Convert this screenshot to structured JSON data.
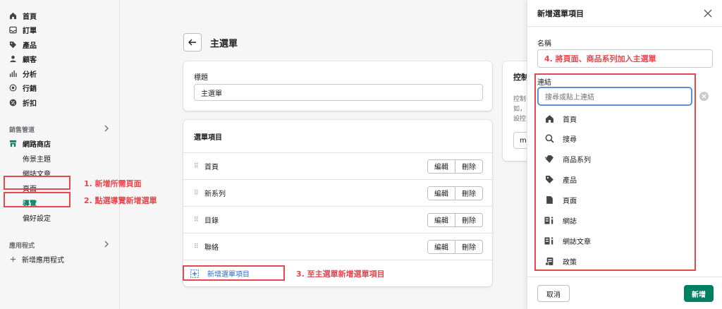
{
  "sidebar": {
    "items": [
      {
        "label": "首頁",
        "icon": "home-icon"
      },
      {
        "label": "訂單",
        "icon": "orders-icon"
      },
      {
        "label": "產品",
        "icon": "tag-icon"
      },
      {
        "label": "顧客",
        "icon": "person-icon"
      },
      {
        "label": "分析",
        "icon": "bar-chart-icon"
      },
      {
        "label": "行銷",
        "icon": "target-icon"
      },
      {
        "label": "折扣",
        "icon": "discount-icon"
      }
    ],
    "sales_channels_label": "銷售管道",
    "online_store_label": "網路商店",
    "store_sub": [
      "佈景主題",
      "網誌文章",
      "頁面",
      "導覽",
      "偏好設定"
    ],
    "apps_label": "應用程式",
    "add_app_label": "新增應用程式"
  },
  "annotations": {
    "step1": "1. 新增所需頁面",
    "step2": "2. 點選導覽新增選單",
    "step3": "3. 至主選單新增選單項目",
    "step4": "4. 將頁面、商品系列加入主選單",
    "color": "#e5484d"
  },
  "main": {
    "title": "主選單",
    "title_field_label": "標題",
    "title_field_value": "主選單",
    "menu_items_title": "選單項目",
    "edit_label": "編輯",
    "delete_label": "刪除",
    "rows": [
      "首頁",
      "新系列",
      "目錄",
      "聯絡"
    ],
    "add_item_label": "新增選單項目",
    "side_card_title": "控制",
    "side_card_text": [
      "控制",
      "如，",
      "設控"
    ],
    "side_card_input": "ma"
  },
  "panel": {
    "title": "新增選單項目",
    "name_label": "名稱",
    "link_label": "連結",
    "link_placeholder": "搜尋或貼上連結",
    "options": [
      {
        "label": "首頁",
        "icon": "home-icon"
      },
      {
        "label": "搜尋",
        "icon": "search-icon"
      },
      {
        "label": "商品系列",
        "icon": "collection-icon"
      },
      {
        "label": "產品",
        "icon": "tag-icon"
      },
      {
        "label": "頁面",
        "icon": "page-icon"
      },
      {
        "label": "網誌",
        "icon": "blog-icon"
      },
      {
        "label": "網誌文章",
        "icon": "blog-post-icon"
      },
      {
        "label": "政策",
        "icon": "policy-icon"
      }
    ],
    "cancel_label": "取消",
    "add_label": "新增",
    "primary_color": "#008060"
  }
}
